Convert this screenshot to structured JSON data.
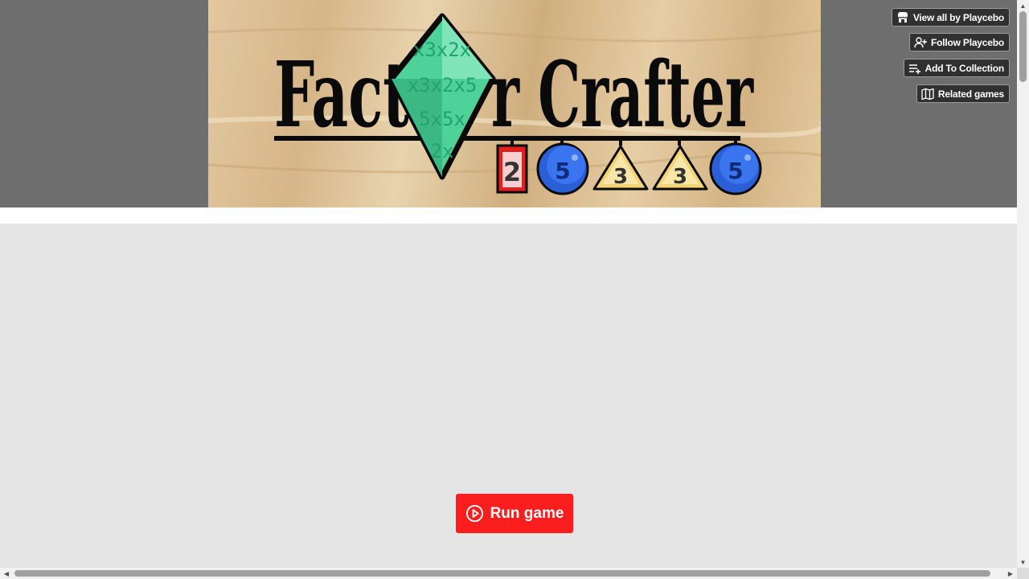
{
  "banner": {
    "title_left": "Fact",
    "title_right": "r Crafter",
    "gem_text": [
      "x3x2x",
      "x3x2x5",
      "5x5x",
      "2x"
    ],
    "tokens": [
      {
        "shape": "rectangle",
        "label": "2",
        "color": "#e41e1e"
      },
      {
        "shape": "circle",
        "label": "5",
        "color": "#2a5fd6"
      },
      {
        "shape": "triangle",
        "label": "3",
        "color": "#f2d477"
      },
      {
        "shape": "triangle",
        "label": "3",
        "color": "#f2d477"
      },
      {
        "shape": "circle",
        "label": "5",
        "color": "#2a5fd6"
      }
    ]
  },
  "actions": {
    "view_all": {
      "label": "View all by Playcebo",
      "icon": "itchio-store-icon"
    },
    "follow": {
      "label": "Follow Playcebo",
      "icon": "user-plus-icon"
    },
    "add_collection": {
      "label": "Add To Collection",
      "icon": "playlist-add-icon"
    },
    "related": {
      "label": "Related games",
      "icon": "map-icon"
    }
  },
  "game": {
    "run_label": "Run game",
    "run_icon": "play-circle-icon"
  },
  "colors": {
    "header_background": "#6e6e6e",
    "game_frame_background": "#e5e5e5",
    "run_button": "#fa1e1e",
    "action_button": "#303030"
  }
}
